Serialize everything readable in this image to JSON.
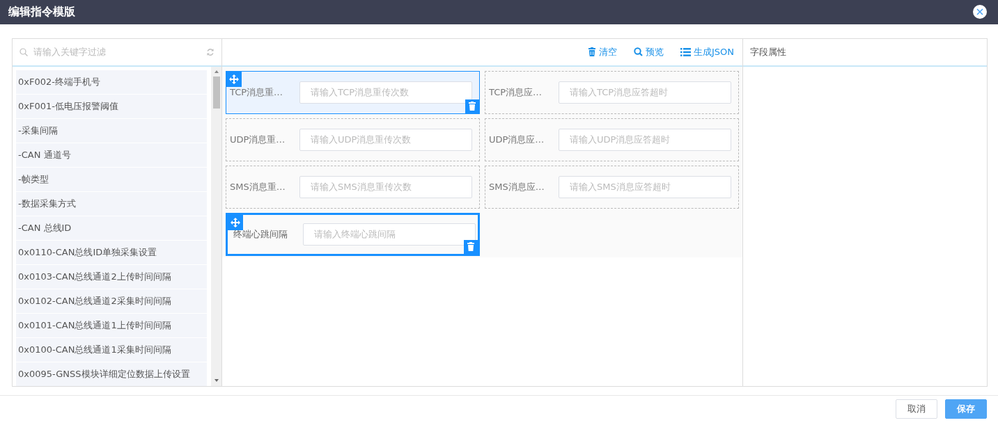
{
  "window": {
    "title": "编辑指令模版"
  },
  "search": {
    "placeholder": "请输入关键字过滤"
  },
  "fields": [
    "0xF002-终端手机号",
    "0xF001-低电压报警阈值",
    "-采集间隔",
    "-CAN 通道号",
    "-帧类型",
    "-数据采集方式",
    "-CAN 总线ID",
    "0x0110-CAN总线ID单独采集设置",
    "0x0103-CAN总线通道2上传时间间隔",
    "0x0102-CAN总线通道2采集时间间隔",
    "0x0101-CAN总线通道1上传时间间隔",
    "0x0100-CAN总线通道1采集时间间隔",
    "0x0095-GNSS模块详细定位数据上传设置"
  ],
  "toolbar": [
    {
      "kind": "clear",
      "label": "清空"
    },
    {
      "kind": "preview",
      "label": "预览"
    },
    {
      "kind": "json",
      "label": "生成JSON"
    }
  ],
  "form_items": [
    {
      "label": "TCP消息重…",
      "placeholder": "请输入TCP消息重传次数",
      "hovered": true,
      "selected": false
    },
    {
      "label": "TCP消息应…",
      "placeholder": "请输入TCP消息应答超时",
      "hovered": false,
      "selected": false
    },
    {
      "label": "UDP消息重…",
      "placeholder": "请输入UDP消息重传次数",
      "hovered": false,
      "selected": false
    },
    {
      "label": "UDP消息应…",
      "placeholder": "请输入UDP消息应答超时",
      "hovered": false,
      "selected": false
    },
    {
      "label": "SMS消息重…",
      "placeholder": "请输入SMS消息重传次数",
      "hovered": false,
      "selected": false
    },
    {
      "label": "SMS消息应…",
      "placeholder": "请输入SMS消息应答超时",
      "hovered": false,
      "selected": false
    },
    {
      "label": "终端心跳间隔",
      "placeholder": "请输入终端心跳间隔",
      "hovered": false,
      "selected": true
    }
  ],
  "properties": {
    "title": "字段属性"
  },
  "buttons": [
    {
      "kind": "cancel",
      "label": "取消"
    },
    {
      "kind": "save",
      "label": "保存"
    }
  ]
}
